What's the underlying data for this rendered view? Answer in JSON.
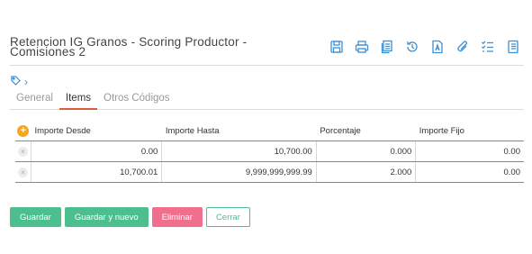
{
  "page": {
    "title": "Retencion IG Granos - Scoring Productor - Comisiones 2"
  },
  "toolbar": {
    "icons": [
      "save-icon",
      "print-icon",
      "copy-icon",
      "history-icon",
      "document-icon",
      "attachment-icon",
      "checklist-icon",
      "book-icon"
    ]
  },
  "breadcrumb": {
    "tag_icon": "tag-icon",
    "chevron": "›"
  },
  "tabs": [
    {
      "label": "General"
    },
    {
      "label": "Items",
      "active": true
    },
    {
      "label": "Otros Códigos"
    }
  ],
  "table": {
    "add_glyph": "+",
    "delete_glyph": "×",
    "columns": [
      "Importe Desde",
      "Importe Hasta",
      "Porcentaje",
      "Importe Fijo"
    ],
    "rows": [
      [
        "0.00",
        "10,700.00",
        "0.000",
        "0.00"
      ],
      [
        "10,700.01",
        "9,999,999,999.99",
        "2.000",
        "0.00"
      ]
    ]
  },
  "actions": {
    "save_label": "Guardar",
    "save_new_label": "Guardar y nuevo",
    "delete_label": "Eliminar",
    "close_label": "Cerrar"
  },
  "colors": {
    "accent": "#3a8fd6",
    "primary_button": "#4dbf8e",
    "danger_button": "#ef6f8c",
    "active_tab": "#e05a3d"
  }
}
